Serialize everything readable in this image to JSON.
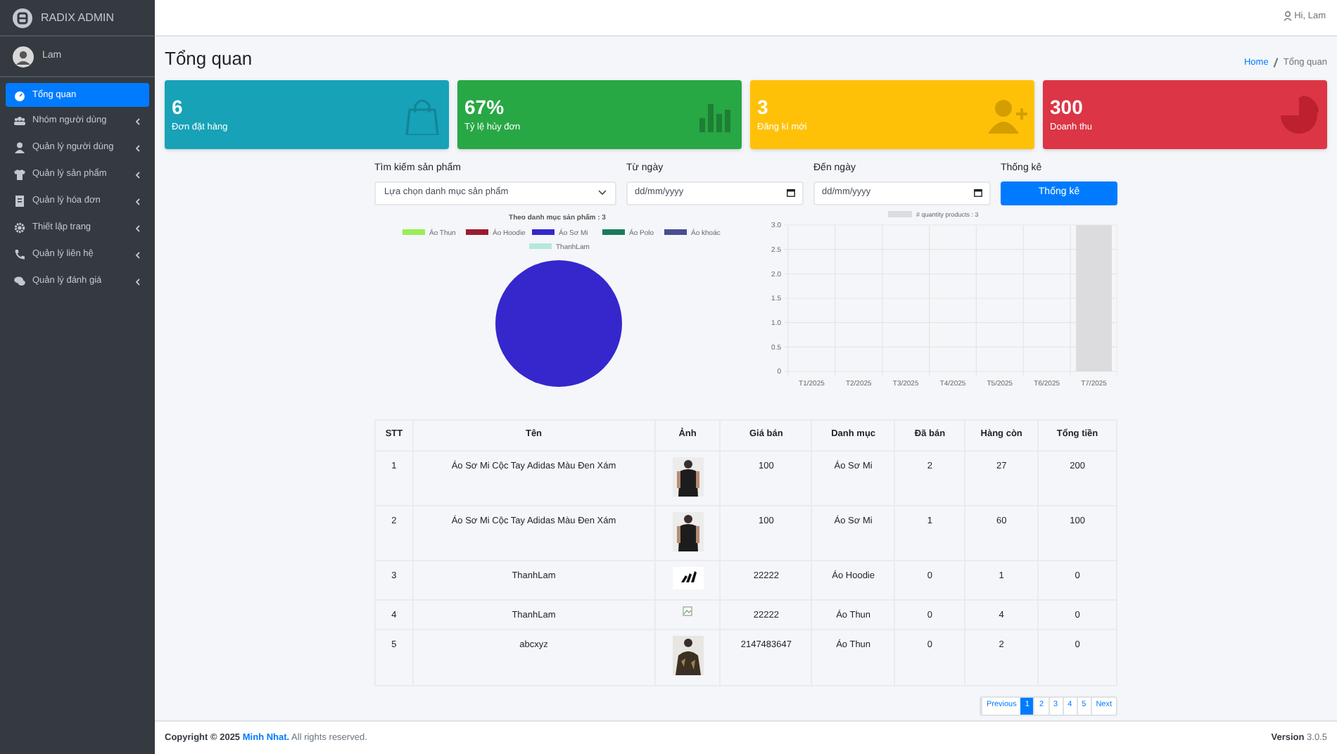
{
  "brand": "RADIX ADMIN",
  "user": {
    "name": "Lam"
  },
  "sidebar": {
    "items": [
      {
        "label": "Tổng quan",
        "selected": true,
        "kind": "link"
      },
      {
        "label": "Nhóm người dùng",
        "selected": false,
        "kind": "menu"
      },
      {
        "label": "Quản lý người dùng",
        "selected": false,
        "kind": "menu"
      },
      {
        "label": "Quản lý sản phẩm",
        "selected": false,
        "kind": "menu"
      },
      {
        "label": "Quản lý hóa đơn",
        "selected": false,
        "kind": "menu"
      },
      {
        "label": "Thiết lập trang",
        "selected": false,
        "kind": "menu"
      },
      {
        "label": "Quản lý liên hệ",
        "selected": false,
        "kind": "menu"
      },
      {
        "label": "Quản lý đánh giá",
        "selected": false,
        "kind": "menu"
      }
    ]
  },
  "header": {
    "greeting": "Hi, Lam"
  },
  "page_title": "Tổng quan",
  "breadcrumb": [
    {
      "label": "Home",
      "selected": false
    },
    {
      "label": "Tổng quan",
      "selected": true
    }
  ],
  "stat_cards": [
    {
      "value": "6",
      "label": "Đơn đặt hàng",
      "color": "#17a2b8"
    },
    {
      "value": "67%",
      "label": "Tỷ lệ hủy đơn",
      "color": "#28a745"
    },
    {
      "value": "3",
      "label": "Đăng kí mới",
      "color": "#ffc107"
    },
    {
      "value": "300",
      "label": "Doanh thu",
      "color": "#dc3545"
    }
  ],
  "filters": {
    "category": {
      "label": "Tìm kiếm sản phẩm",
      "value": "Lựa chọn danh mục sản phẩm"
    },
    "from": {
      "label": "Từ ngày",
      "placeholder": "dd/mm/yyyy"
    },
    "to": {
      "label": "Đến ngày",
      "placeholder": "dd/mm/yyyy"
    },
    "submit": {
      "label": "Thống kê",
      "button": {
        "label": "Thống kê"
      }
    }
  },
  "pie_chart": {
    "legend": [
      {
        "color": "#99ee55"
      },
      {
        "color": "#9b1b30"
      },
      {
        "color": "#3527cc"
      },
      {
        "color": "#1b7a5c"
      },
      {
        "color": "#4a4d8f"
      },
      {
        "color": "#b5e8dc"
      }
    ],
    "chart_data": {
      "type": "pie",
      "title": "Theo danh mục sản phẩm : 3",
      "categories": [
        "Áo Thun",
        "Áo Hoodie",
        "Áo Sơ Mi",
        "Áo Polo",
        "Áo khoác",
        "ThanhLam"
      ],
      "values": [
        0,
        0,
        100,
        0,
        0,
        0
      ]
    }
  },
  "bar_chart": {
    "chart_data": {
      "type": "bar",
      "categories": [
        "T1/2025",
        "T2/2025",
        "T3/2025",
        "T4/2025",
        "T5/2025",
        "T6/2025",
        "T7/2025"
      ],
      "series": [
        {
          "name": "# quantity products : 3",
          "color": "#dcdcdf",
          "values": [
            0,
            0,
            0,
            0,
            0,
            0,
            3
          ]
        }
      ],
      "grid": true,
      "ylim": [
        0,
        3
      ],
      "yticks": [
        {
          "value": 0,
          "label": "0"
        },
        {
          "value": 0.5,
          "label": "0.5"
        },
        {
          "value": 1,
          "label": "1.0"
        },
        {
          "value": 1.5,
          "label": "1.5"
        },
        {
          "value": 2,
          "label": "2.0"
        },
        {
          "value": 2.5,
          "label": "2.5"
        },
        {
          "value": 3,
          "label": "3.0"
        }
      ]
    }
  },
  "table": {
    "columns": [
      "STT",
      "Tên",
      "Ảnh",
      "Giá bán",
      "Danh mục",
      "Đã bán",
      "Hàng còn",
      "Tổng tiền"
    ],
    "rows": [
      {
        "stt": "1",
        "name": "Áo Sơ Mi Cộc Tay Adidas Màu Đen Xám",
        "price": "100",
        "category": "Áo Sơ Mi",
        "sold": "2",
        "stock": "27",
        "total": "200"
      },
      {
        "stt": "2",
        "name": "Áo Sơ Mi Cộc Tay Adidas Màu Đen Xám",
        "price": "100",
        "category": "Áo Sơ Mi",
        "sold": "1",
        "stock": "60",
        "total": "100"
      },
      {
        "stt": "3",
        "name": "ThanhLam",
        "price": "22222",
        "category": "Áo Hoodie",
        "sold": "0",
        "stock": "1",
        "total": "0"
      },
      {
        "stt": "4",
        "name": "ThanhLam",
        "image": {
          "kind": "broken"
        },
        "price": "22222",
        "category": "Áo Thun",
        "sold": "0",
        "stock": "4",
        "total": "0"
      },
      {
        "stt": "5",
        "name": "abcxyz",
        "price": "2147483647",
        "category": "Áo Thun",
        "sold": "0",
        "stock": "2",
        "total": "0"
      }
    ]
  },
  "pagination": [
    {
      "label": "Previous",
      "selected": false
    },
    {
      "label": "1",
      "selected": true
    },
    {
      "label": "2",
      "selected": false
    },
    {
      "label": "3",
      "selected": false
    },
    {
      "label": "4",
      "selected": false
    },
    {
      "label": "5",
      "selected": false
    },
    {
      "label": "Next",
      "selected": false
    }
  ],
  "footer": {
    "copyright": "Copyright © 2025",
    "author": "Minh Nhat.",
    "rights": "All rights reserved.",
    "version_label": "Version",
    "version": "3.0.5"
  }
}
